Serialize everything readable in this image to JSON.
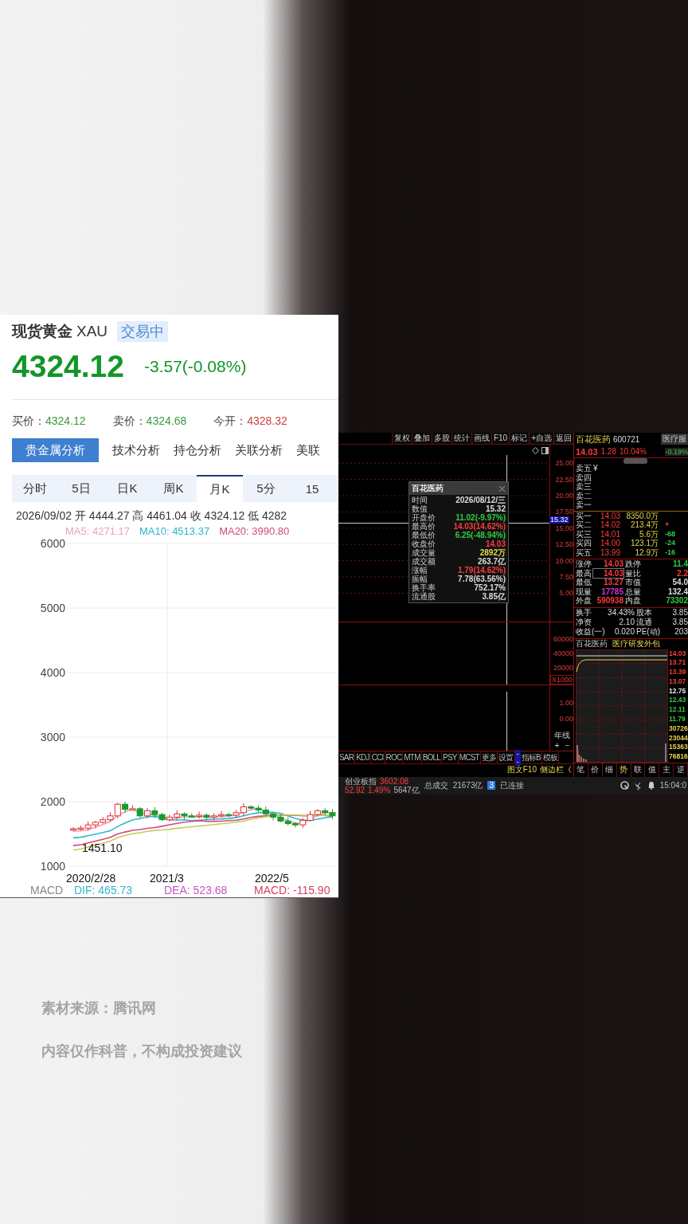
{
  "gold": {
    "name": "现货黄金",
    "code": "XAU",
    "status": "交易中",
    "price": "4324.12",
    "change": "-3.57(-0.08%)",
    "quotes": [
      {
        "label": "买价：",
        "value": "4324.12",
        "color": "#3a9a3a"
      },
      {
        "label": "卖价：",
        "value": "4324.68",
        "color": "#3a9a3a"
      },
      {
        "label": "今开：",
        "value": "4328.32",
        "color": "#d04040"
      }
    ],
    "tabs": [
      {
        "label": "贵金属分析",
        "selected": true
      },
      {
        "label": "技术分析",
        "selected": false
      },
      {
        "label": "持仓分析",
        "selected": false
      },
      {
        "label": "关联分析",
        "selected": false
      },
      {
        "label": "美联",
        "selected": false
      }
    ],
    "periods": [
      {
        "label": "分时",
        "selected": false
      },
      {
        "label": "5日",
        "selected": false
      },
      {
        "label": "日K",
        "selected": false
      },
      {
        "label": "周K",
        "selected": false
      },
      {
        "label": "月K",
        "selected": true
      },
      {
        "label": "5分",
        "selected": false
      },
      {
        "label": "15",
        "selected": false
      }
    ],
    "bar_info": "2026/09/02  开 4444.27  高 4461.04  收 4324.12  低 4282",
    "ma": [
      {
        "text": "MA5: 4271.17",
        "color": "#eba3bd"
      },
      {
        "text": "MA10: 4513.37",
        "color": "#2fb6cf"
      },
      {
        "text": "MA20: 3990.80",
        "color": "#d4487a"
      }
    ],
    "y_axis": [
      "6000",
      "5000",
      "4000",
      "3000",
      "2000",
      "1000"
    ],
    "x_axis": [
      "2020/2/28",
      "2021/3",
      "2022/5"
    ],
    "low_label": "1451.10",
    "macd_label": "MACD",
    "macd": [
      {
        "text": "DIF: 465.73",
        "color": "#2fb6cf"
      },
      {
        "text": "DEA: 523.68",
        "color": "#c455c4"
      },
      {
        "text": "MACD: -115.90",
        "color": "#d4405e"
      }
    ]
  },
  "terminal": {
    "toolbar": [
      "复权",
      "叠加",
      "多股",
      "统计",
      "画线",
      "F10",
      "标记",
      "+自选",
      "返回"
    ],
    "price_axis": [
      "25.00",
      "22.50",
      "20.00",
      "17.50",
      "15.00",
      "12.50",
      "10.00",
      "7.50",
      "5.00"
    ],
    "cursor_value": "15.32",
    "tooltip": {
      "title": "百花医药",
      "rows": [
        {
          "label": "时间",
          "value": "2026/08/12/三",
          "color": "#dddddd"
        },
        {
          "label": "数值",
          "value": "15.32",
          "color": "#dddddd"
        },
        {
          "label": "开盘价",
          "value": "11.02(-9.97%)",
          "color": "#2ecc40"
        },
        {
          "label": "最高价",
          "value": "14.03(14.62%)",
          "color": "#ff3b3b"
        },
        {
          "label": "最低价",
          "value": "6.25(-48.94%)",
          "color": "#2ecc40"
        },
        {
          "label": "收盘价",
          "value": "14.03",
          "color": "#ff3b3b"
        },
        {
          "label": "成交量",
          "value": "2892万",
          "color": "#e6d84a"
        },
        {
          "label": "成交额",
          "value": "263.7亿",
          "color": "#dddddd"
        },
        {
          "label": "涨幅",
          "value": "1.79(14.62%)",
          "color": "#ff3b3b"
        },
        {
          "label": "振幅",
          "value": "7.78(63.56%)",
          "color": "#dddddd"
        },
        {
          "label": "换手率",
          "value": "752.17%",
          "color": "#dddddd"
        },
        {
          "label": "流通股",
          "value": "3.85亿",
          "color": "#dddddd"
        }
      ]
    },
    "volume_axis": [
      "60000",
      "40000",
      "20000"
    ],
    "volume_unit": "X1000",
    "macd_axis": [
      "1.00",
      "0.00"
    ],
    "indicators": [
      "SAR",
      "KDJ",
      "CCI",
      "ROC",
      "MTM",
      "BOLL",
      "PSY",
      "MCST",
      "更多",
      "设置"
    ],
    "cursor_tag": "--",
    "tools": [
      "指标B",
      "模板"
    ],
    "period": "年线",
    "zoom": [
      "+",
      "−"
    ],
    "links": [
      "图文F10",
      "侧边栏《"
    ],
    "stock": {
      "name": "百花医药",
      "code": "600721",
      "price": "14.03",
      "change": "1.28",
      "pct": "10.04%",
      "sector": "医疗服",
      "sector_change": "-0.19%"
    },
    "asks": [
      {
        "label": "卖五",
        "currency": "¥"
      },
      {
        "label": "卖四"
      },
      {
        "label": "卖三"
      },
      {
        "label": "卖二"
      },
      {
        "label": "卖一"
      }
    ],
    "bids": [
      {
        "label": "买一",
        "price": "14.03",
        "volume": "8350.0万"
      },
      {
        "label": "买二",
        "price": "14.02",
        "volume": "213.4万",
        "delta": "+",
        "color": "#ff3b3b"
      },
      {
        "label": "买三",
        "price": "14.01",
        "volume": "5.6万",
        "delta": "-68",
        "color": "#2ecc40"
      },
      {
        "label": "买四",
        "price": "14.00",
        "volume": "123.1万",
        "delta": "-24",
        "color": "#2ecc40"
      },
      {
        "label": "买五",
        "price": "13.99",
        "volume": "12.9万",
        "delta": "-16",
        "color": "#2ecc40"
      }
    ],
    "stats": [
      {
        "left": {
          "label": "涨停",
          "value": "14.03",
          "color": "#ff3b3b"
        },
        "right": {
          "label": "跌停",
          "value": "11.4",
          "color": "#2ecc40"
        }
      },
      {
        "left": {
          "label": "最高",
          "value": "14.03",
          "color": "#ff3b3b",
          "boxed": true
        },
        "right": {
          "label": "量比",
          "value": "2.2",
          "color": "#ff3b3b"
        }
      },
      {
        "left": {
          "label": "最低",
          "value": "13.27",
          "color": "#ff3b3b"
        },
        "right": {
          "label": "市值",
          "value": "54.0",
          "color": "#dddddd"
        }
      },
      {
        "left": {
          "label": "现量",
          "value": "17785",
          "color": "#d030d0"
        },
        "right": {
          "label": "总量",
          "value": "132.4",
          "color": "#dddddd"
        }
      },
      {
        "left": {
          "label": "外盘",
          "value": "590938",
          "color": "#ff3b3b"
        },
        "right": {
          "label": "内盘",
          "value": "73302",
          "color": "#2ecc40"
        }
      }
    ],
    "finance": [
      {
        "label": "换手",
        "value": "34.43%",
        "label2": "股本",
        "value2": "3.85"
      },
      {
        "label": "净资",
        "value": "2.10",
        "label2": "流通",
        "value2": "3.85"
      },
      {
        "label": "收益(一)",
        "value": "0.020",
        "label2": "PE(动)",
        "value2": "203"
      }
    ],
    "mini": {
      "name": "百花医药",
      "concept": "医疗研发外包",
      "axis": [
        {
          "text": "14.03",
          "color": "#ff3b3b"
        },
        {
          "text": "13.71",
          "color": "#ff3b3b"
        },
        {
          "text": "13.39",
          "color": "#ff3b3b"
        },
        {
          "text": "13.07",
          "color": "#ff3b3b"
        },
        {
          "text": "12.75",
          "color": "#eeeeee"
        },
        {
          "text": "12.43",
          "color": "#2ecc40"
        },
        {
          "text": "12.11",
          "color": "#2ecc40"
        },
        {
          "text": "11.79",
          "color": "#2ecc40"
        },
        {
          "text": "30726",
          "color": "#e6d84a"
        },
        {
          "text": "23044",
          "color": "#e6d84a"
        },
        {
          "text": "15363",
          "color": "#e6d84a"
        },
        {
          "text": "76816",
          "color": "#e6d84a"
        }
      ]
    },
    "tabs": [
      {
        "label": "笔",
        "selected": false
      },
      {
        "label": "价",
        "selected": false
      },
      {
        "label": "细",
        "selected": false
      },
      {
        "label": "势",
        "selected": true
      },
      {
        "label": "联",
        "selected": false
      },
      {
        "label": "值",
        "selected": false
      },
      {
        "label": "主",
        "selected": false
      },
      {
        "label": "逆",
        "selected": false
      }
    ],
    "status": {
      "index_name": "创业板指",
      "index_value": "3602.08",
      "index_change": "52.92",
      "index_pct": "1.49%",
      "index_amount": "5647亿",
      "total_label": "总成交",
      "total_value": "21673亿",
      "conn_count": "3",
      "conn_label": "已连接",
      "time": "15:04:0"
    }
  },
  "captions": [
    "素材来源：腾讯网",
    "内容仅作科普，不构成投资建议"
  ]
}
